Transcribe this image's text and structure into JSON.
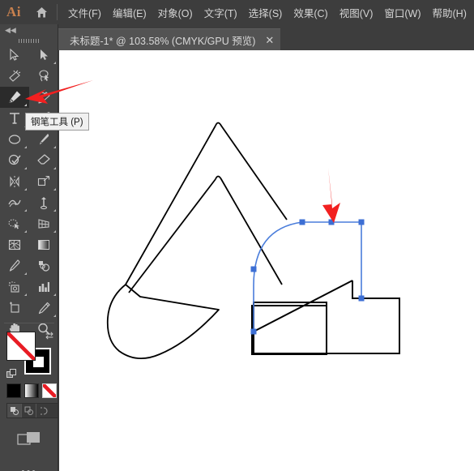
{
  "app": {
    "name": "Ai",
    "logo_color": "#c8814e",
    "home_icon": "home-icon"
  },
  "menubar": {
    "items": [
      {
        "label": "文件(F)",
        "name": "menu-file"
      },
      {
        "label": "编辑(E)",
        "name": "menu-edit"
      },
      {
        "label": "对象(O)",
        "name": "menu-object"
      },
      {
        "label": "文字(T)",
        "name": "menu-type"
      },
      {
        "label": "选择(S)",
        "name": "menu-select"
      },
      {
        "label": "效果(C)",
        "name": "menu-effect"
      },
      {
        "label": "视图(V)",
        "name": "menu-view"
      },
      {
        "label": "窗口(W)",
        "name": "menu-window"
      },
      {
        "label": "帮助(H)",
        "name": "menu-help"
      }
    ]
  },
  "tab": {
    "title": "未标题-1* @ 103.58% (CMYK/GPU 预览)",
    "close_label": "✕",
    "zoom_level": "103.58%",
    "color_mode": "CMYK/GPU 预览",
    "document_name": "未标题-1*",
    "modified": true
  },
  "toolpanel": {
    "collapse_label": "◀◀",
    "selected_tool": "pen-tool",
    "tools": [
      {
        "name": "selection-tool",
        "label": "选择工具",
        "has_flyout": false
      },
      {
        "name": "direct-selection-tool",
        "label": "直接选择工具",
        "has_flyout": true
      },
      {
        "name": "magic-wand-tool",
        "label": "魔棒工具",
        "has_flyout": false
      },
      {
        "name": "lasso-tool",
        "label": "套索工具",
        "has_flyout": false
      },
      {
        "name": "pen-tool",
        "label": "钢笔工具",
        "has_flyout": true
      },
      {
        "name": "curvature-tool",
        "label": "曲率工具",
        "has_flyout": false
      },
      {
        "name": "type-tool",
        "label": "文字工具",
        "has_flyout": true
      },
      {
        "name": "line-segment-tool",
        "label": "直线段工具",
        "has_flyout": true
      },
      {
        "name": "ellipse-tool",
        "label": "椭圆工具",
        "has_flyout": true
      },
      {
        "name": "paintbrush-tool",
        "label": "画笔工具",
        "has_flyout": true
      },
      {
        "name": "shaper-tool",
        "label": "Shaper 工具",
        "has_flyout": true
      },
      {
        "name": "eraser-tool",
        "label": "橡皮擦工具",
        "has_flyout": true
      },
      {
        "name": "rotate-tool",
        "label": "旋转工具",
        "has_flyout": true
      },
      {
        "name": "scale-tool",
        "label": "比例缩放工具",
        "has_flyout": true
      },
      {
        "name": "width-tool",
        "label": "宽度工具",
        "has_flyout": true
      },
      {
        "name": "free-transform-tool",
        "label": "自由变换工具",
        "has_flyout": true
      },
      {
        "name": "shape-builder-tool",
        "label": "形状生成器工具",
        "has_flyout": true
      },
      {
        "name": "perspective-grid-tool",
        "label": "透视网格工具",
        "has_flyout": true
      },
      {
        "name": "mesh-tool",
        "label": "网格工具",
        "has_flyout": false
      },
      {
        "name": "gradient-tool",
        "label": "渐变工具",
        "has_flyout": false
      },
      {
        "name": "eyedropper-tool",
        "label": "吸管工具",
        "has_flyout": true
      },
      {
        "name": "blend-tool",
        "label": "混合工具",
        "has_flyout": false
      },
      {
        "name": "symbol-sprayer-tool",
        "label": "符号喷枪工具",
        "has_flyout": true
      },
      {
        "name": "column-graph-tool",
        "label": "柱形图工具",
        "has_flyout": true
      },
      {
        "name": "artboard-tool",
        "label": "画板工具",
        "has_flyout": false
      },
      {
        "name": "slice-tool",
        "label": "切片工具",
        "has_flyout": true
      },
      {
        "name": "hand-tool",
        "label": "抓手工具",
        "has_flyout": true
      },
      {
        "name": "zoom-tool",
        "label": "缩放工具",
        "has_flyout": false
      }
    ],
    "fill": {
      "name": "fill-swatch",
      "value": "none",
      "color": "#ffffff"
    },
    "stroke": {
      "name": "stroke-swatch",
      "value": "black",
      "color": "#000000"
    },
    "swap_label": "⇄",
    "swatches": [
      {
        "name": "swatch-color",
        "label": "颜色",
        "active": false
      },
      {
        "name": "swatch-gradient",
        "label": "渐变",
        "active": false
      },
      {
        "name": "swatch-none",
        "label": "无",
        "active": true
      }
    ],
    "draw_modes": [
      {
        "name": "draw-normal-mode",
        "label": "正常绘图",
        "active": true
      },
      {
        "name": "draw-behind-mode",
        "label": "背面绘图",
        "active": false
      },
      {
        "name": "draw-inside-mode",
        "label": "内部绘图",
        "active": false
      }
    ],
    "screen_mode": {
      "name": "screen-mode-button",
      "label": "更改屏幕模式"
    },
    "more_label": "•••"
  },
  "tooltip": {
    "text": "钢笔工具 (P)",
    "visible": true
  },
  "canvas": {
    "background": "#ffffff",
    "stroke_color": "#000000",
    "selection_color": "#4a7ddb",
    "anchor_color": "#3d6fd4",
    "annotation_color": "#f22020",
    "shapes": [
      {
        "name": "excavator-arm-outline",
        "type": "path",
        "selected": false
      },
      {
        "name": "excavator-bucket-outline",
        "type": "path",
        "selected": false
      },
      {
        "name": "cab-body-rectangle",
        "type": "path",
        "selected": false
      },
      {
        "name": "cab-roof-selected-path",
        "type": "path",
        "selected": true
      }
    ],
    "annotations": [
      {
        "name": "arrow-to-pen-tool",
        "direction": "left",
        "color": "#f22020"
      },
      {
        "name": "arrow-to-selected-path",
        "direction": "down",
        "color": "#f22020"
      }
    ]
  }
}
